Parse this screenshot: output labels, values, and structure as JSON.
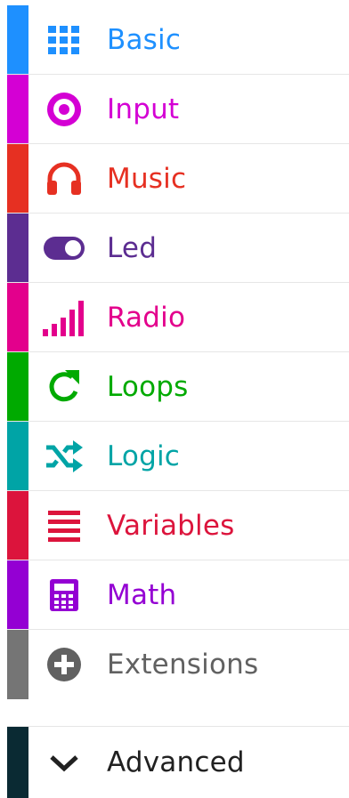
{
  "toolbox": {
    "categories": [
      {
        "label": "Basic",
        "color": "#1e90ff",
        "icon": "grid-icon"
      },
      {
        "label": "Input",
        "color": "#d400d4",
        "icon": "radio-button-icon"
      },
      {
        "label": "Music",
        "color": "#e63022",
        "icon": "headphones-icon"
      },
      {
        "label": "Led",
        "color": "#5c2d91",
        "icon": "toggle-icon"
      },
      {
        "label": "Radio",
        "color": "#e3008c",
        "icon": "signal-bars-icon"
      },
      {
        "label": "Loops",
        "color": "#00aa00",
        "icon": "refresh-icon"
      },
      {
        "label": "Logic",
        "color": "#00a4a6",
        "icon": "shuffle-icon"
      },
      {
        "label": "Variables",
        "color": "#dc143c",
        "icon": "list-lines-icon"
      },
      {
        "label": "Math",
        "color": "#9400d3",
        "icon": "calculator-icon"
      },
      {
        "label": "Extensions",
        "color": "#616161",
        "stripe_color": "#757575",
        "icon": "plus-circle-icon"
      }
    ],
    "advanced": {
      "label": "Advanced",
      "color": "#212121",
      "stripe_color": "#0a2a33",
      "icon": "chevron-down-icon"
    }
  }
}
